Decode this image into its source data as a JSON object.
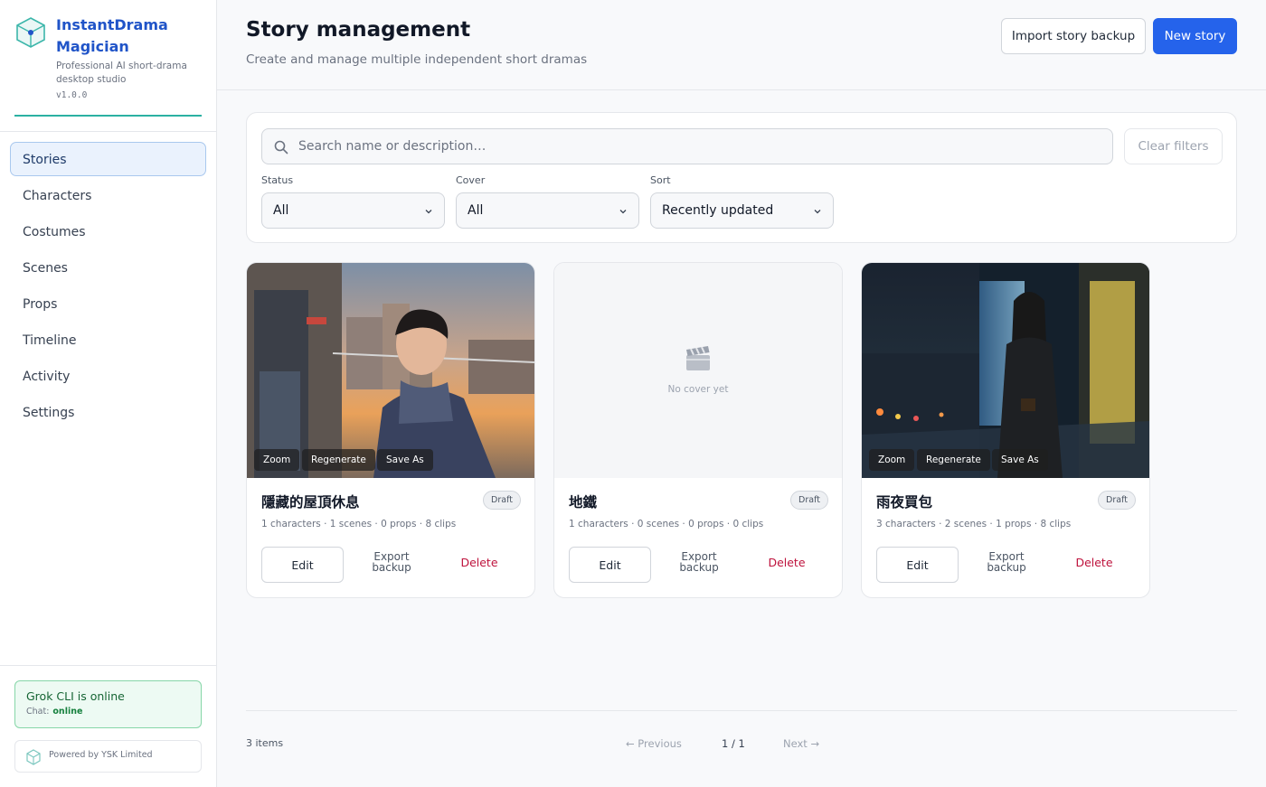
{
  "app": {
    "name": "InstantDrama Magician",
    "tagline": "Professional AI short-drama desktop studio",
    "version": "v1.0.0"
  },
  "sidebar": {
    "items": [
      {
        "label": "Stories",
        "active": true
      },
      {
        "label": "Characters"
      },
      {
        "label": "Costumes"
      },
      {
        "label": "Scenes"
      },
      {
        "label": "Props"
      },
      {
        "label": "Timeline"
      },
      {
        "label": "Activity"
      },
      {
        "label": "Settings"
      }
    ],
    "status": {
      "title": "Grok CLI is online",
      "chat_label": "Chat:",
      "chat_value": "online"
    },
    "powered_by": "Powered by YSK Limited"
  },
  "header": {
    "title": "Story management",
    "subtitle": "Create and manage multiple independent short dramas",
    "import_label": "Import story backup",
    "new_label": "New story"
  },
  "filters": {
    "search_placeholder": "Search name or description…",
    "search_value": "",
    "clear_label": "Clear filters",
    "status": {
      "label": "Status",
      "value": "All"
    },
    "cover": {
      "label": "Cover",
      "value": "All"
    },
    "sort": {
      "label": "Sort",
      "value": "Recently updated"
    }
  },
  "stories": [
    {
      "title": "隱藏的屋頂休息",
      "badge": "Draft",
      "meta": "1 characters · 1 scenes · 0 props · 8 clips",
      "has_cover": true,
      "cover_icon": "rooftop-selfie-photo"
    },
    {
      "title": "地鐵",
      "badge": "Draft",
      "meta": "1 characters · 0 scenes · 0 props · 0 clips",
      "has_cover": false,
      "no_cover_text": "No cover yet",
      "cover_icon": "clapperboard-icon"
    },
    {
      "title": "雨夜買包",
      "badge": "Draft",
      "meta": "3 characters · 2 scenes · 1 props · 8 clips",
      "has_cover": true,
      "cover_icon": "rainy-night-street-photo"
    }
  ],
  "card_actions": {
    "zoom": "Zoom",
    "regenerate": "Regenerate",
    "save_as": "Save As",
    "edit": "Edit",
    "export": "Export backup",
    "delete": "Delete"
  },
  "pagination": {
    "count": "3 items",
    "prev": "← Previous",
    "page": "1 / 1",
    "next": "Next →"
  },
  "colors": {
    "accent": "#2563eb",
    "brand": "#2054c8",
    "brand_line": "#2bb1a2",
    "delete": "#be123c",
    "online": "#15803d"
  }
}
